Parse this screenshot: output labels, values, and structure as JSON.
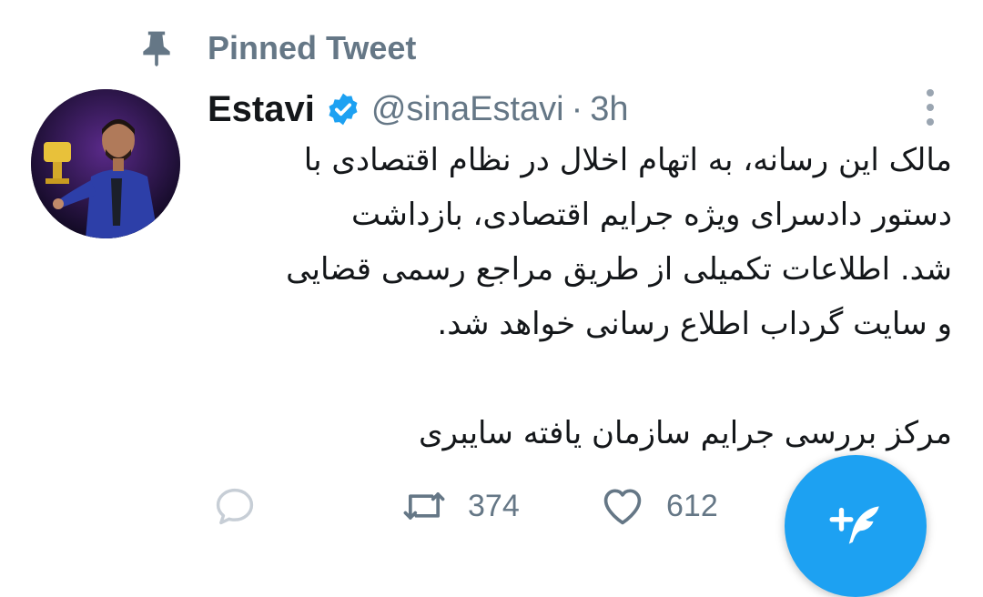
{
  "pinned": {
    "label": "Pinned Tweet"
  },
  "tweet": {
    "display_name": "Estavi",
    "verified": true,
    "handle": "@sinaEstavi",
    "separator": "·",
    "time": "3h",
    "lines": [
      "مالک این رسانه، به اتهام اخلال در نظام اقتصادی با",
      "دستور دادسرای ویژه جرایم  اقتصادی، بازداشت",
      "شد. اطلاعات تکمیلی از طریق مراجع رسمی قضایی",
      "و سایت گرداب اطلاع رسانی خواهد شد."
    ],
    "signature": "مرکز بررسی جرایم سازمان یافته سایبری"
  },
  "actions": {
    "reply_count": "",
    "retweet_count": "374",
    "like_count": "612"
  },
  "icons": {
    "pin": "pin-icon",
    "verified": "verified-badge-icon",
    "more": "more-vertical-icon",
    "reply": "reply-icon",
    "retweet": "retweet-icon",
    "like": "heart-icon",
    "compose": "compose-tweet-icon"
  },
  "colors": {
    "accent": "#1da1f2",
    "muted": "#657786",
    "text": "#14171a"
  }
}
